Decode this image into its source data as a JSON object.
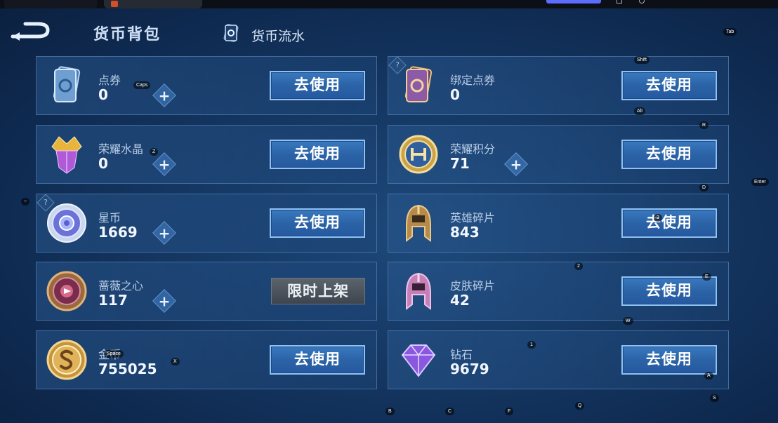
{
  "header": {
    "title": "货币背包",
    "tab_flow": "货币流水"
  },
  "currencies": [
    {
      "name": "点券",
      "value": "0",
      "action": "去使用"
    },
    {
      "name": "绑定点券",
      "value": "0",
      "action": "去使用"
    },
    {
      "name": "荣耀水晶",
      "value": "0",
      "action": "去使用"
    },
    {
      "name": "荣耀积分",
      "value": "71",
      "action": "去使用"
    },
    {
      "name": "星币",
      "value": "1669",
      "action": "去使用"
    },
    {
      "name": "英雄碎片",
      "value": "843",
      "action": "去使用"
    },
    {
      "name": "蔷薇之心",
      "value": "117",
      "action": "限时上架"
    },
    {
      "name": "皮肤碎片",
      "value": "42",
      "action": "去使用"
    },
    {
      "name": "金币",
      "value": "755025",
      "action": "去使用"
    },
    {
      "name": "钻石",
      "value": "9679",
      "action": "去使用"
    }
  ],
  "plus_symbol": "+",
  "question_symbol": "?",
  "key_hints": {
    "tab": "Tab",
    "shift": "Shift",
    "alt": "Alt",
    "caps": "Caps",
    "r": "R",
    "z": "Z",
    "enter": "Enter",
    "d": "D",
    "tilde": "~",
    "three": "3",
    "two": "2",
    "e": "E",
    "w": "W",
    "one": "1",
    "x": "X",
    "a": "A",
    "space": "Space",
    "s": "S",
    "b": "B",
    "c": "C",
    "f": "F",
    "q": "Q"
  },
  "colors": {
    "background": "#163a66",
    "button_blue": "#2b63a6",
    "button_border": "#8ec2f5",
    "limited_gray": "#4a525c"
  }
}
